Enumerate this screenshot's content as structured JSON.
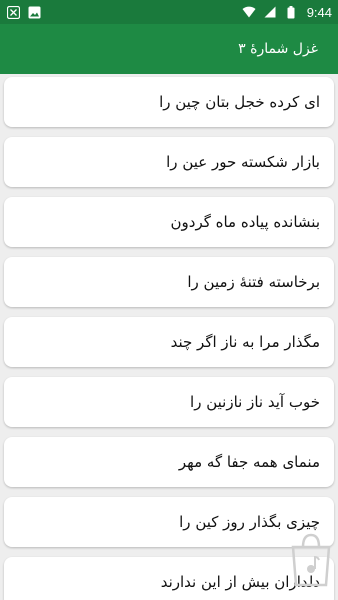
{
  "status_bar": {
    "time": "9:44",
    "left_icons": [
      "notification-icon",
      "image-icon"
    ],
    "right_icons": [
      "wifi-icon",
      "signal-icon",
      "battery-icon"
    ]
  },
  "app_bar": {
    "title": "غزل شمارهٔ ۳",
    "background": "#1e8a44"
  },
  "verses": [
    "ای کرده خجل بتان چین را",
    "بازار شکسته حور عین را",
    "بنشانده پیاده ماه گردون",
    "برخاسته فتنهٔ زمین را",
    "مگذار مرا به ناز اگر چند",
    "خوب آید ناز نازنین را",
    "منمای همه جفا گه مهر",
    "چیزی بگذار روز کین را",
    "دلداران بیش از این ندارند"
  ],
  "watermark": {
    "icon": "store-logo-icon"
  }
}
